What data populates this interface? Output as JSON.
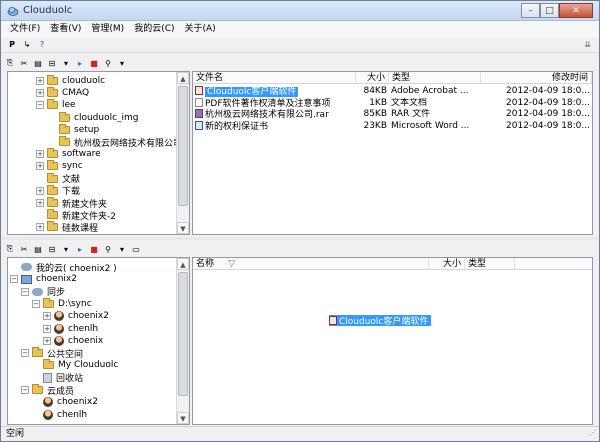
{
  "window": {
    "title": "Clouduolc",
    "minimize": "–",
    "maximize": "□",
    "close": "✕"
  },
  "menu": [
    "文件(F)",
    "查看(V)",
    "管理(M)",
    "我的云(C)",
    "关于(A)"
  ],
  "top_toolbar": {
    "icons": [
      "P",
      "↳",
      "?"
    ]
  },
  "upper_toolbar": {
    "icons": [
      "⎘",
      "✂",
      "▤",
      "⊟",
      "▾",
      "▸",
      "■",
      "⚲",
      "▾"
    ]
  },
  "lower_toolbar": {
    "icons": [
      "⎘",
      "✂",
      "▤",
      "⊟",
      "▾",
      "▸",
      "■",
      "⚲",
      "▾",
      "▭"
    ]
  },
  "upper_tree": [
    {
      "label": "clouduolc",
      "expander": "+",
      "icon": "folder-icon"
    },
    {
      "label": "CMAQ",
      "expander": "+",
      "icon": "folder-icon"
    },
    {
      "label": "lee",
      "expander": "−",
      "icon": "folder-icon"
    },
    {
      "label": "clouduolc_img",
      "expander": "",
      "icon": "folder-icon"
    },
    {
      "label": "setup",
      "expander": "",
      "icon": "folder-icon"
    },
    {
      "label": "杭州极云网络技术有限公司",
      "expander": "",
      "icon": "folder-icon"
    },
    {
      "label": "software",
      "expander": "+",
      "icon": "folder-icon"
    },
    {
      "label": "sync",
      "expander": "+",
      "icon": "folder-icon"
    },
    {
      "label": "文献",
      "expander": "",
      "icon": "folder-icon"
    },
    {
      "label": "下载",
      "expander": "+",
      "icon": "folder-icon"
    },
    {
      "label": "新建文件夹",
      "expander": "+",
      "icon": "folder-icon"
    },
    {
      "label": "新建文件夹-2",
      "expander": "",
      "icon": "folder-icon"
    },
    {
      "label": "硅数课程",
      "expander": "+",
      "icon": "folder-icon"
    }
  ],
  "file_list": {
    "columns": {
      "name": "文件名",
      "size": "大小",
      "type": "类型",
      "modified": "修改时间"
    },
    "rows": [
      {
        "name": "Clouduolc客户端软件",
        "size": "84KB",
        "type": "Adobe Acrobat ...",
        "modified": "2012-04-09 18:0...",
        "icon": "pdf-icon"
      },
      {
        "name": "PDF软件著作权清单及注意事项",
        "size": "1KB",
        "type": "文本文档",
        "modified": "2012-04-09 18:0...",
        "icon": "text-file-icon"
      },
      {
        "name": "杭州极云网络技术有限公司.rar",
        "size": "85KB",
        "type": "RAR 文件",
        "modified": "2012-04-09 18:0...",
        "icon": "rar-icon"
      },
      {
        "name": "新的权利保证书",
        "size": "23KB",
        "type": "Microsoft Word ...",
        "modified": "2012-04-09 18:0...",
        "icon": "word-icon"
      }
    ]
  },
  "lower_tree": [
    {
      "label": "我的云( choenix2 )",
      "expander": "",
      "icon": "cloud-icon"
    },
    {
      "label": "choenix2",
      "expander": "−",
      "icon": "computer-icon"
    },
    {
      "label": "同步",
      "expander": "−",
      "icon": "sync-icon"
    },
    {
      "label": "D:\\sync",
      "expander": "−",
      "icon": "folder-icon"
    },
    {
      "label": "choenix2",
      "expander": "+",
      "icon": "user-icon"
    },
    {
      "label": "chenlh",
      "expander": "+",
      "icon": "user-icon"
    },
    {
      "label": "choenix",
      "expander": "+",
      "icon": "user-icon"
    },
    {
      "label": "公共空间",
      "expander": "−",
      "icon": "folder-icon"
    },
    {
      "label": "My Clouduolc",
      "expander": "",
      "icon": "folder-icon"
    },
    {
      "label": "回收站",
      "expander": "",
      "icon": "recycle-bin-icon"
    },
    {
      "label": "云成员",
      "expander": "−",
      "icon": "folder-icon"
    },
    {
      "label": "choenix2",
      "expander": "",
      "icon": "user-icon"
    },
    {
      "label": "chenlh",
      "expander": "",
      "icon": "user-icon"
    }
  ],
  "lower_list": {
    "columns": {
      "name": "名称",
      "sort_arrow": "▽",
      "size": "大小",
      "type": "类型"
    },
    "drag_item": "Clouduolc客户端软件"
  },
  "status": "空闲"
}
